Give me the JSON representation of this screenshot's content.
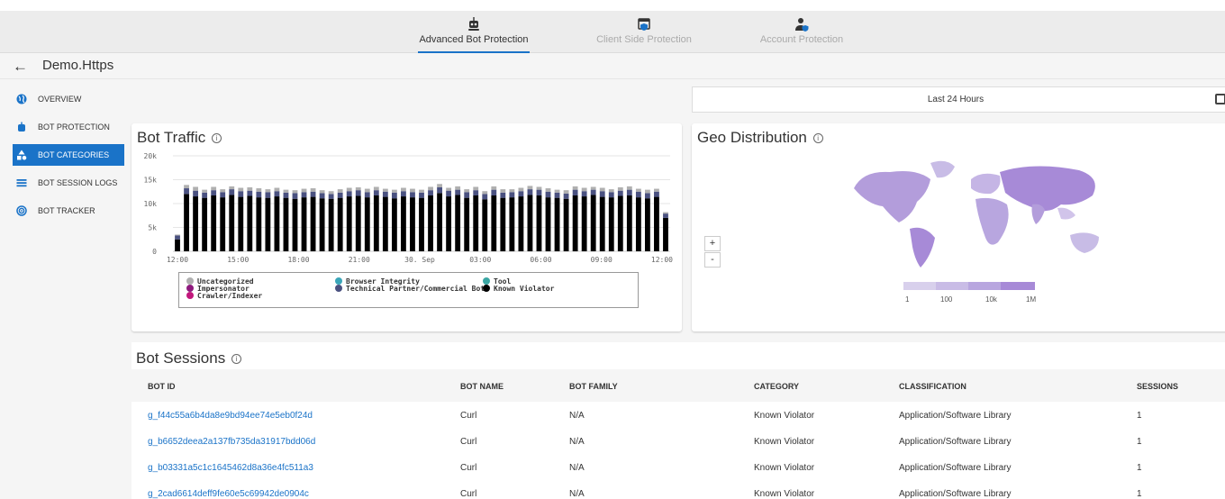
{
  "top_nav": {
    "tabs": [
      {
        "label": "Advanced Bot Protection",
        "icon": "robot-icon",
        "active": true
      },
      {
        "label": "Client Side Protection",
        "icon": "browser-shield-icon",
        "active": false
      },
      {
        "label": "Account Protection",
        "icon": "user-shield-icon",
        "active": false
      }
    ]
  },
  "breadcrumb": {
    "app_name": "Demo.Https"
  },
  "sidebar": {
    "items": [
      {
        "label": "OVERVIEW",
        "icon": "globe-icon",
        "active": false
      },
      {
        "label": "BOT PROTECTION",
        "icon": "bot-icon",
        "active": false
      },
      {
        "label": "BOT CATEGORIES",
        "icon": "shapes-icon",
        "active": true
      },
      {
        "label": "BOT SESSION LOGS",
        "icon": "list-icon",
        "active": false
      },
      {
        "label": "BOT TRACKER",
        "icon": "target-icon",
        "active": false
      }
    ]
  },
  "time_range": {
    "label": "Last 24 Hours"
  },
  "bot_traffic": {
    "title": "Bot Traffic",
    "legend": [
      {
        "label": "Uncategorized",
        "color": "#b0b0b0"
      },
      {
        "label": "Impersonator",
        "color": "#8e1a7e"
      },
      {
        "label": "Crawler/Indexer",
        "color": "#c2187c"
      },
      {
        "label": "Browser Integrity",
        "color": "#3aa6b9"
      },
      {
        "label": "Technical Partner/Commercial Bot",
        "color": "#4a5180"
      },
      {
        "label": "Tool",
        "color": "#3aa6a3"
      },
      {
        "label": "Known Violator",
        "color": "#000000"
      }
    ]
  },
  "chart_data": {
    "type": "bar",
    "stacked": true,
    "ylim": [
      0,
      20000
    ],
    "y_ticks": [
      "0",
      "5k",
      "10k",
      "15k",
      "20k"
    ],
    "x_ticks": [
      "12:00",
      "15:00",
      "18:00",
      "21:00",
      "30. Sep",
      "03:00",
      "06:00",
      "09:00",
      "12:00"
    ],
    "series": [
      {
        "name": "Known Violator",
        "color": "#000000",
        "values": [
          2500,
          12000,
          11500,
          11200,
          11700,
          11300,
          11800,
          11400,
          11600,
          11300,
          11200,
          11500,
          11200,
          11000,
          11300,
          11400,
          11100,
          11000,
          11200,
          11500,
          11600,
          11300,
          11700,
          11400,
          11100,
          11500,
          11300,
          11200,
          11700,
          12200,
          11500,
          11800,
          11200,
          11700,
          10900,
          11700,
          11200,
          11300,
          11500,
          11800,
          11700,
          11300,
          11200,
          11000,
          11700,
          11500,
          11800,
          11400,
          11300,
          11600,
          11700,
          11300,
          11100,
          11400,
          7000
        ]
      },
      {
        "name": "Technical Partner/Commercial Bot",
        "color": "#4a5180",
        "values": [
          800,
          1200,
          1200,
          1100,
          1100,
          1100,
          1200,
          1200,
          1100,
          1200,
          1200,
          1100,
          1100,
          1200,
          1100,
          1100,
          1100,
          1000,
          1100,
          1100,
          1200,
          1100,
          1100,
          1100,
          1200,
          1100,
          1100,
          1100,
          1100,
          1200,
          1200,
          1100,
          1200,
          1100,
          1100,
          1200,
          1100,
          1100,
          1100,
          1200,
          1200,
          1200,
          1100,
          1100,
          1200,
          1100,
          1100,
          1200,
          1100,
          1100,
          1200,
          1200,
          1100,
          1100,
          900
        ]
      },
      {
        "name": "Uncategorized",
        "color": "#b0b0b0",
        "values": [
          200,
          700,
          800,
          600,
          700,
          600,
          600,
          700,
          700,
          700,
          600,
          700,
          600,
          600,
          700,
          700,
          600,
          600,
          700,
          700,
          600,
          700,
          700,
          600,
          600,
          700,
          700,
          600,
          700,
          700,
          600,
          700,
          600,
          700,
          600,
          700,
          700,
          600,
          700,
          700,
          600,
          700,
          600,
          700,
          700,
          700,
          600,
          700,
          600,
          700,
          700,
          600,
          700,
          600,
          300
        ]
      }
    ]
  },
  "geo": {
    "title": "Geo Distribution",
    "zoom_in": "+",
    "zoom_out": "-",
    "scale_labels": [
      "1",
      "100",
      "10k",
      "1M"
    ],
    "scale_colors": [
      "#d8d0ec",
      "#c9bce6",
      "#b8a6df",
      "#a78ad7"
    ]
  },
  "sessions": {
    "title": "Bot Sessions",
    "columns": [
      "BOT ID",
      "BOT NAME",
      "BOT FAMILY",
      "CATEGORY",
      "CLASSIFICATION",
      "SESSIONS"
    ],
    "rows": [
      [
        "g_f44c55a6b4da8e9bd94ee74e5eb0f24d",
        "Curl",
        "N/A",
        "Known Violator",
        "Application/Software Library",
        "1"
      ],
      [
        "g_b6652deea2a137fb735da31917bdd06d",
        "Curl",
        "N/A",
        "Known Violator",
        "Application/Software Library",
        "1"
      ],
      [
        "g_b03331a5c1c1645462d8a36e4fc511a3",
        "Curl",
        "N/A",
        "Known Violator",
        "Application/Software Library",
        "1"
      ],
      [
        "g_2cad6614deff9fe60e5c69942de0904c",
        "Curl",
        "N/A",
        "Known Violator",
        "Application/Software Library",
        "1"
      ]
    ]
  }
}
